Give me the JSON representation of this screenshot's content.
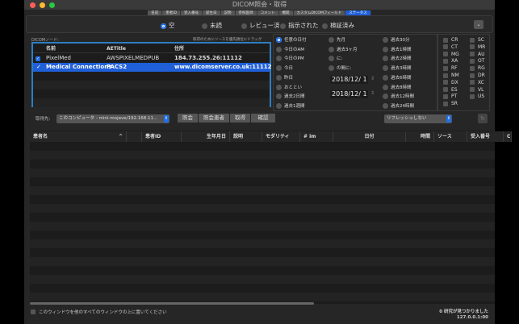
{
  "window": {
    "title": "DICOM照会・取得"
  },
  "tabs": [
    "名前",
    "患者ID",
    "受入番号",
    "誕生日",
    "説明",
    "参照医師",
    "コメント",
    "機関",
    "カスタムDICOMフィールド",
    "ステータス"
  ],
  "status_filters": [
    {
      "label": "空",
      "selected": true
    },
    {
      "label": "未読",
      "selected": false
    },
    {
      "label": "レビュー済",
      "selected": false
    },
    {
      "label": "指示された",
      "selected": false
    },
    {
      "label": "検証済み",
      "selected": false
    }
  ],
  "nodes": {
    "label": "DICOMノード:",
    "hint": "取得のためにソースを優先順位にドラッグ",
    "columns": [
      "名前",
      "AETitle",
      "住所"
    ],
    "rows": [
      {
        "checked": true,
        "name": "PixelMed",
        "aetitle": "AWSPIXELMEDPUB",
        "address": "184.73.255.26:11112",
        "selected": false
      },
      {
        "checked": true,
        "name": "Medical Connections",
        "aetitle": "PACS2",
        "address": "www.dicomserver.co.uk:11112",
        "selected": true
      }
    ]
  },
  "dates": {
    "col1": [
      {
        "label": "任意の日付",
        "selected": true
      },
      {
        "label": "今日のAM"
      },
      {
        "label": "今日のPM"
      },
      {
        "label": "今日"
      },
      {
        "label": "昨日"
      },
      {
        "label": "おととい"
      },
      {
        "label": "過去2日間"
      },
      {
        "label": "過去1週間"
      }
    ],
    "col2": [
      {
        "label": "先月"
      },
      {
        "label": "過去3ヶ月"
      },
      {
        "label": "に:"
      },
      {
        "label": "の間に:"
      }
    ],
    "col3": [
      {
        "label": "過去30分"
      },
      {
        "label": "過去1時間"
      },
      {
        "label": "過去2時間"
      },
      {
        "label": "過去3時間"
      },
      {
        "label": "過去6時間"
      },
      {
        "label": "過去8時間"
      },
      {
        "label": "過去12時間"
      },
      {
        "label": "過去24時間"
      }
    ],
    "date_from": "2018/12/ 1",
    "date_to": "2018/12/ 1"
  },
  "modalities": {
    "left": [
      "CR",
      "CT",
      "MG",
      "XA",
      "RF",
      "NM",
      "DX",
      "ES",
      "PT",
      "SR"
    ],
    "right": [
      "SC",
      "MR",
      "AU",
      "OT",
      "RG",
      "DR",
      "XC",
      "VL",
      "US"
    ]
  },
  "toolbar": {
    "retrieve_to_label": "取得先:",
    "retrieve_to_value": "このコンピュータ - mini-mojave/192.168.11...",
    "buttons": [
      "照会",
      "照会患者",
      "取得",
      "確認"
    ],
    "refresh_value": "リフレッシュしない"
  },
  "table": {
    "columns": [
      "患者名",
      "",
      "患者ID",
      "生年月日",
      "説明",
      "モダリティ",
      "# im",
      "日付",
      "時間",
      "ソース",
      "受入番号",
      "C"
    ]
  },
  "footer": {
    "keep_on_top": "このウィンドウを他のすべてのウィンドウの上に置いてください",
    "result_count": "0 研究が見つかりました",
    "address": "127.0.0.1:00"
  }
}
